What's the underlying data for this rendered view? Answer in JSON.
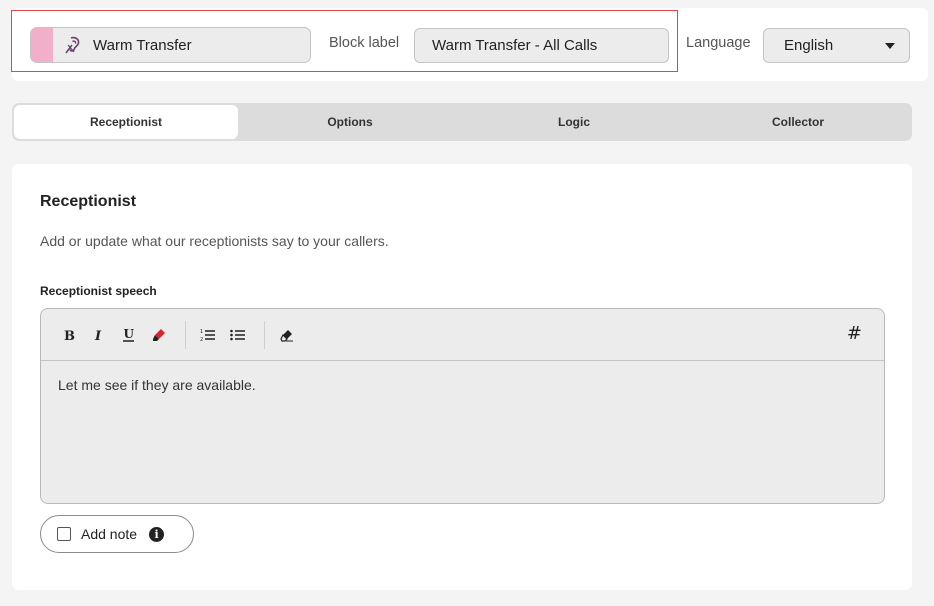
{
  "header": {
    "block_type": {
      "label": "Warm Transfer",
      "icon": "warm-transfer-icon",
      "swatch_color": "#f2afc9"
    },
    "block_label": {
      "caption": "Block label",
      "value": "Warm Transfer - All Calls"
    },
    "language": {
      "caption": "Language",
      "selected": "English"
    },
    "highlight_color": "#e0474c"
  },
  "tabs": [
    {
      "label": "Receptionist",
      "active": true
    },
    {
      "label": "Options",
      "active": false
    },
    {
      "label": "Logic",
      "active": false
    },
    {
      "label": "Collector",
      "active": false
    }
  ],
  "main": {
    "title": "Receptionist",
    "description": "Add or update what our receptionists say to your callers.",
    "speech_field": {
      "label": "Receptionist speech",
      "toolbar": [
        "bold-icon",
        "italic-icon",
        "underline-icon",
        "highlighter-icon",
        "ordered-list-icon",
        "bullet-list-icon",
        "eraser-icon",
        "hash-icon"
      ],
      "hash_label": "#",
      "content": "Let me see if they are available."
    },
    "add_note": {
      "label": "Add note",
      "checked": false,
      "info_glyph": "i"
    }
  }
}
